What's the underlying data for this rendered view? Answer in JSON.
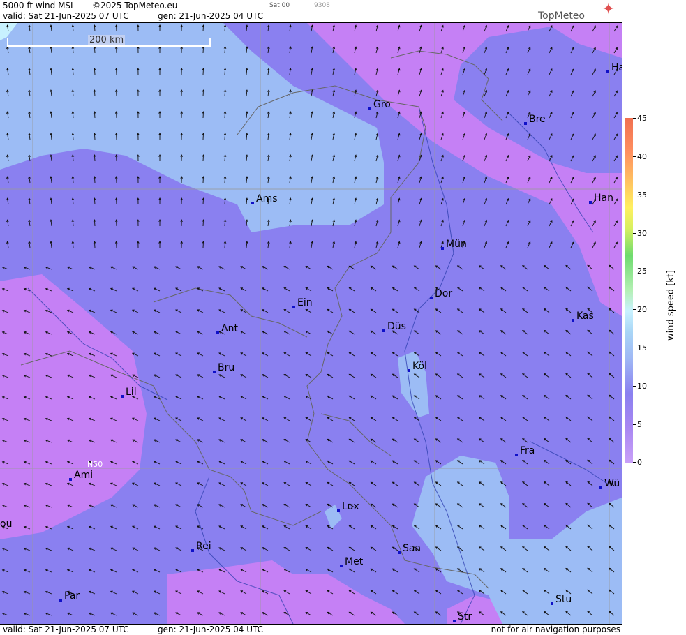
{
  "header": {
    "product": "5000 ft wind MSL",
    "copyright": "©2025 TopMeteo.eu",
    "satellite": "Sat 00",
    "code": "9308",
    "valid": "valid:  Sat  21-Jun-2025  07 UTC",
    "generated": "gen:  21-Jun-2025  04 UTC"
  },
  "logo": {
    "text": "TopMeteo",
    "icon": "compass-star-icon"
  },
  "scale": {
    "label": "200 km"
  },
  "grid_label": "N50",
  "cities": [
    {
      "name": "Gro"
    },
    {
      "name": "Bre"
    },
    {
      "name": "Ha"
    },
    {
      "name": "Ams"
    },
    {
      "name": "Han"
    },
    {
      "name": "Mün"
    },
    {
      "name": "Ein"
    },
    {
      "name": "Dor"
    },
    {
      "name": "Ant"
    },
    {
      "name": "Düs"
    },
    {
      "name": "Kas"
    },
    {
      "name": "Bru"
    },
    {
      "name": "Köl"
    },
    {
      "name": "Lil"
    },
    {
      "name": "Fra"
    },
    {
      "name": "Ami"
    },
    {
      "name": "Wü"
    },
    {
      "name": "Lux"
    },
    {
      "name": "ou"
    },
    {
      "name": "Rei"
    },
    {
      "name": "Saa"
    },
    {
      "name": "Met"
    },
    {
      "name": "Stu"
    },
    {
      "name": "Par"
    },
    {
      "name": "Str"
    }
  ],
  "legend": {
    "title": "wind  speed  [kt]",
    "ticks": [
      "45",
      "40",
      "35",
      "30",
      "25",
      "20",
      "15",
      "10",
      "5",
      "0"
    ]
  },
  "footer": {
    "valid": "valid:  Sat  21-Jun-2025  07 UTC",
    "generated": "gen:  21-Jun-2025  04 UTC",
    "disclaimer": "not for air navigation purposes"
  },
  "colors": {
    "calm": "#c580f5",
    "light": "#8a80f0",
    "moderate": "#9cbcf5",
    "fresh": "#c8f2ff"
  }
}
